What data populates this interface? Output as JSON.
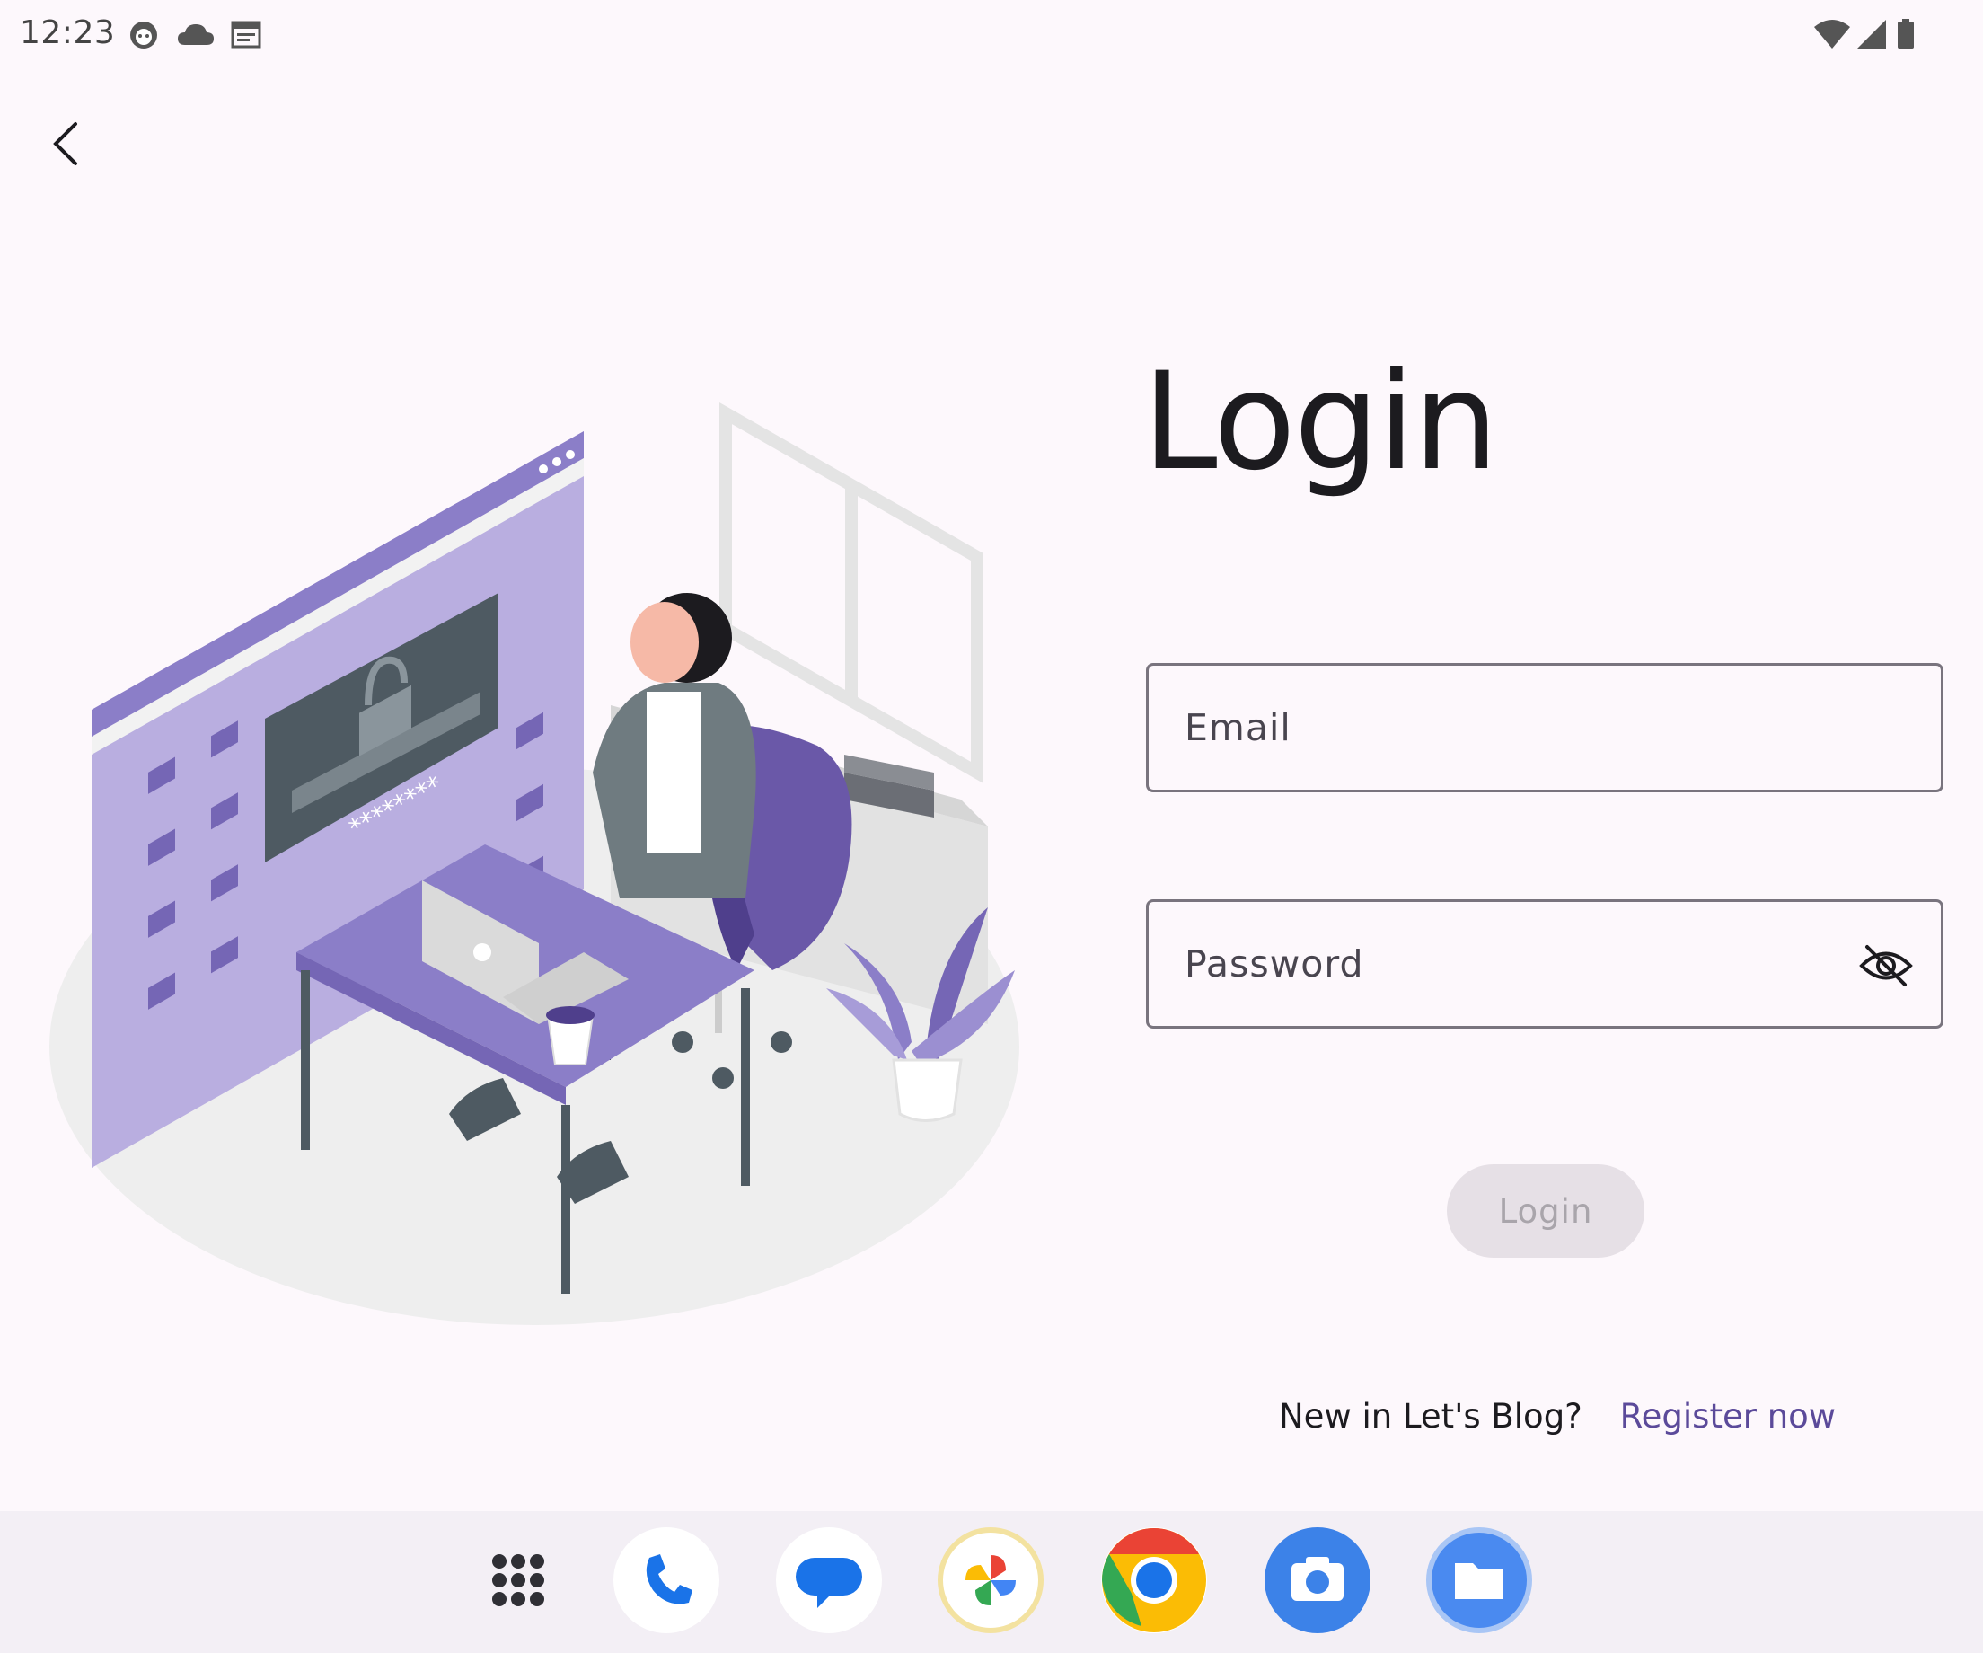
{
  "status_bar": {
    "time": "12:23",
    "left_icons": [
      "face-notification-icon",
      "cloud-icon",
      "calendar-icon"
    ],
    "right_icons": [
      "wifi-icon",
      "cell-signal-icon",
      "battery-icon"
    ]
  },
  "toolbar": {
    "back_icon": "back-arrow-icon"
  },
  "login": {
    "title": "Login",
    "email_label": "Email",
    "password_label": "Password",
    "password_visibility_icon": "eye-off-icon",
    "submit_label": "Login",
    "register_prompt": "New in Let's Blog?",
    "register_link": "Register now"
  },
  "illustration": {
    "password_mask": "********"
  },
  "dock": {
    "apps": [
      "app-drawer-icon",
      "phone-icon",
      "messages-icon",
      "photos-icon",
      "chrome-icon",
      "camera-icon",
      "files-icon"
    ]
  },
  "colors": {
    "background": "#fdf8fc",
    "accent": "#5b4a9a",
    "outline": "#79747e",
    "disabled_button": "#e6e0e6",
    "illustration_purple": "#8b7ec8"
  }
}
